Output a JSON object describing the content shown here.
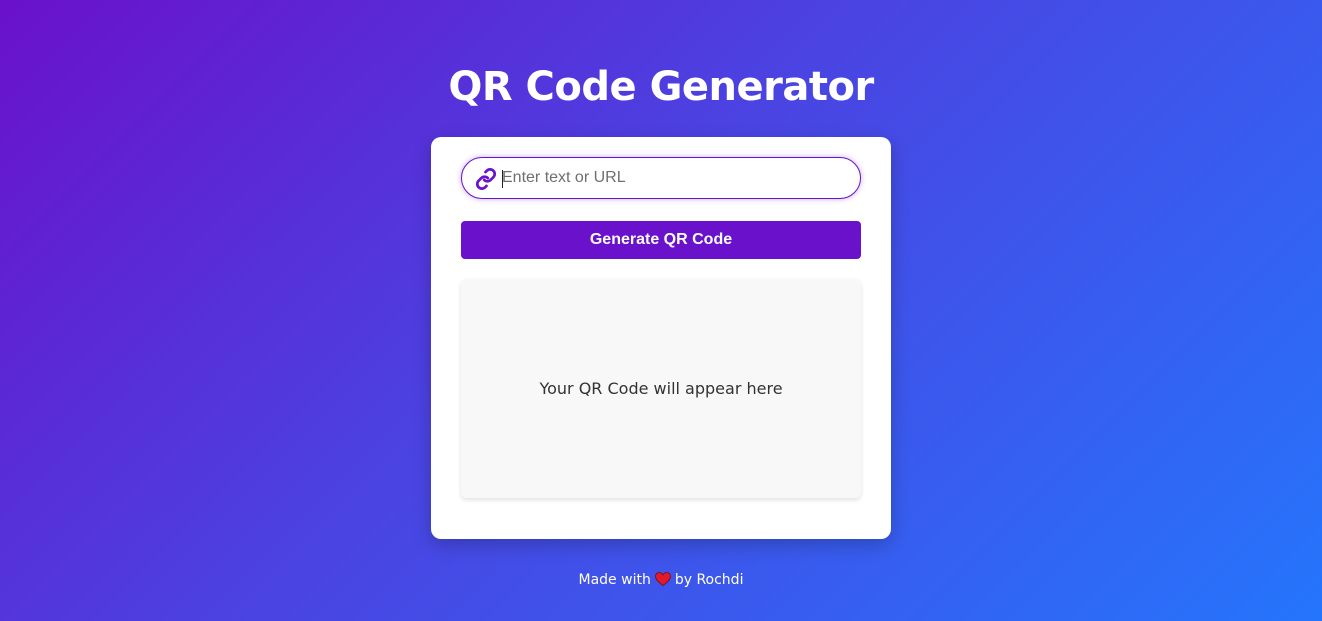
{
  "page": {
    "title": "QR Code Generator"
  },
  "form": {
    "input_placeholder": "Enter text or URL",
    "input_value": "",
    "input_icon": "link-icon",
    "generate_label": "Generate QR Code"
  },
  "result": {
    "placeholder_text": "Your QR Code will appear here"
  },
  "footer": {
    "made_with": "Made with",
    "heart_icon": "heart-icon",
    "by": "by Rochdi"
  },
  "colors": {
    "accent": "#6a11cb",
    "gradient_start": "#6a11cb",
    "gradient_end": "#2575fc",
    "card": "#ffffff",
    "heart": "#e0192b"
  }
}
